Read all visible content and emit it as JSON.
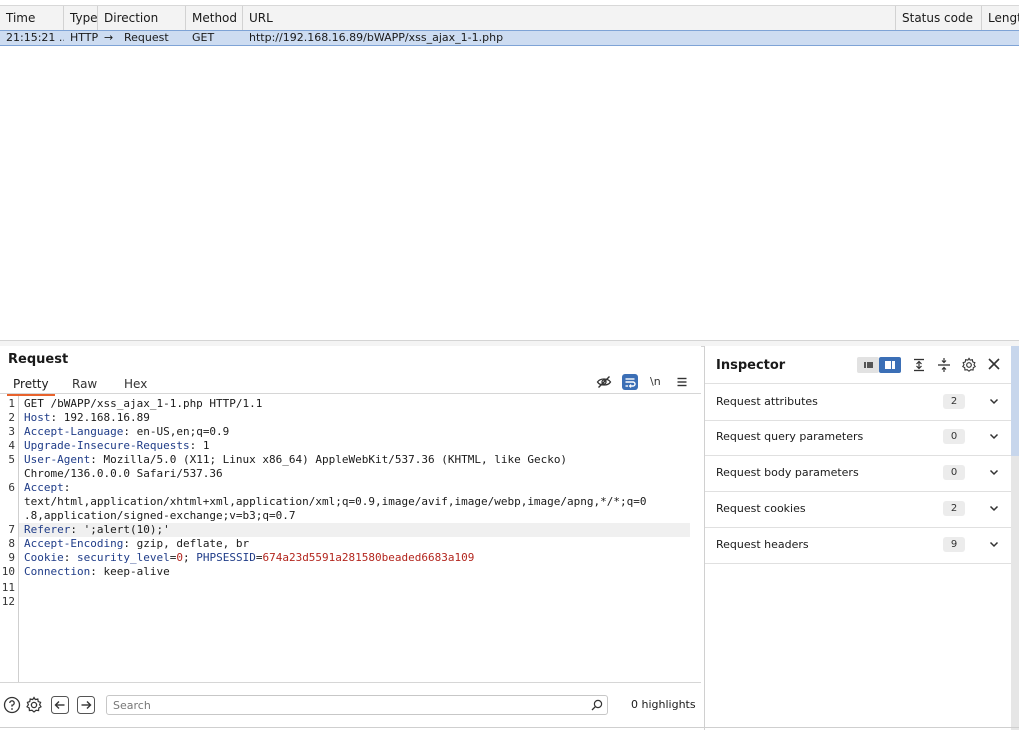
{
  "history": {
    "columns": [
      "Time",
      "Type",
      "Direction",
      "Method",
      "URL",
      "Status code",
      "Length"
    ],
    "rows": [
      {
        "time": "21:15:21 ...",
        "type": "HTTP",
        "direction_arrow": "→",
        "direction": "Request",
        "method": "GET",
        "url": "http://192.168.16.89/bWAPP/xss_ajax_1-1.php",
        "status": "",
        "length": ""
      }
    ]
  },
  "request": {
    "title": "Request",
    "tabs": [
      "Pretty",
      "Raw",
      "Hex"
    ],
    "active_tab": "Pretty",
    "newline_label": "\\n",
    "line_numbers": [
      "1",
      "2",
      "3",
      "4",
      "5",
      "6",
      "7",
      "8",
      "9",
      "10",
      "11",
      "12"
    ],
    "lines": {
      "l1": "GET /bWAPP/xss_ajax_1-1.php HTTP/1.1",
      "l2_key": "Host",
      "l2_val": ": 192.168.16.89",
      "l3_key": "Accept-Language",
      "l3_val": ": en-US,en;q=0.9",
      "l4_key": "Upgrade-Insecure-Requests",
      "l4_val": ": 1",
      "l5_key": "User-Agent",
      "l5_val": ": Mozilla/5.0 (X11; Linux x86_64) AppleWebKit/537.36 (KHTML, like Gecko)",
      "l5_cont": "Chrome/136.0.0.0 Safari/537.36",
      "l6_key": "Accept",
      "l6_val": ":",
      "l6_cont1": "text/html,application/xhtml+xml,application/xml;q=0.9,image/avif,image/webp,image/apng,*/*;q=0",
      "l6_cont2": ".8,application/signed-exchange;v=b3;q=0.7",
      "l7_key": "Referer",
      "l7_val": ": ';alert(10);'",
      "l8_key": "Accept-Encoding",
      "l8_val": ": gzip, deflate, br",
      "l9_key": "Cookie",
      "l9_sep": ": ",
      "l9_c1k": "security_level",
      "l9_c1v": "0",
      "l9_semi": "; ",
      "l9_c2k": "PHPSESSID",
      "l9_c2v": "674a23d5591a281580beaded6683a109",
      "l10_key": "Connection",
      "l10_val": ": keep-alive"
    },
    "search_placeholder": "Search",
    "highlights": "0 highlights"
  },
  "inspector": {
    "title": "Inspector",
    "sections": [
      {
        "label": "Request attributes",
        "count": "2"
      },
      {
        "label": "Request query parameters",
        "count": "0"
      },
      {
        "label": "Request body parameters",
        "count": "0"
      },
      {
        "label": "Request cookies",
        "count": "2"
      },
      {
        "label": "Request headers",
        "count": "9"
      }
    ]
  },
  "colors": {
    "accent_tab": "#e8622c",
    "selected_row": "#cddcf1",
    "header_key": "#1f3c88",
    "cookie_value": "#b3261e",
    "toggle_active": "#3b6fb6"
  },
  "icons": [
    "hide-icon",
    "wrap-icon",
    "menu-icon",
    "help-icon",
    "gear-icon",
    "back-arrow-icon",
    "forward-arrow-icon",
    "search-icon",
    "layout-list-icon",
    "layout-split-icon",
    "expand-icon",
    "collapse-icon",
    "settings-icon",
    "close-icon",
    "chevron-down-icon"
  ]
}
